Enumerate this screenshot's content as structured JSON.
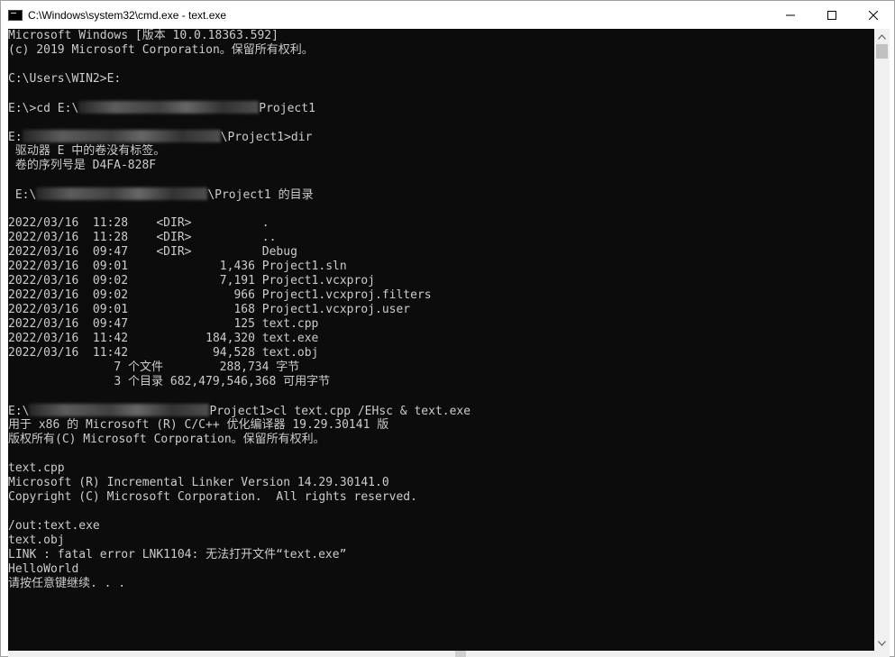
{
  "window": {
    "title": "C:\\Windows\\system32\\cmd.exe - text.exe",
    "controls": {
      "minimize": "minimize",
      "maximize": "maximize",
      "close": "close"
    }
  },
  "console": {
    "lines": [
      {
        "text": "Microsoft Windows [版本 10.0.18363.592]"
      },
      {
        "text": "(c) 2019 Microsoft Corporation。保留所有权利。"
      },
      {
        "text": ""
      },
      {
        "text": "C:\\Users\\WIN2>E:"
      },
      {
        "text": ""
      },
      {
        "prefix": "E:\\>cd E:\\",
        "blur": 200,
        "suffix": "Project1"
      },
      {
        "text": ""
      },
      {
        "prefix": "E:",
        "blur": 220,
        "suffix": "\\Project1>dir"
      },
      {
        "text": " 驱动器 E 中的卷没有标签。"
      },
      {
        "text": " 卷的序列号是 D4FA-828F"
      },
      {
        "text": ""
      },
      {
        "prefix": " E:\\",
        "blur": 190,
        "suffix": "\\Project1 的目录"
      },
      {
        "text": ""
      },
      {
        "text": "2022/03/16  11:28    <DIR>          ."
      },
      {
        "text": "2022/03/16  11:28    <DIR>          .."
      },
      {
        "text": "2022/03/16  09:47    <DIR>          Debug"
      },
      {
        "text": "2022/03/16  09:01             1,436 Project1.sln"
      },
      {
        "text": "2022/03/16  09:02             7,191 Project1.vcxproj"
      },
      {
        "text": "2022/03/16  09:02               966 Project1.vcxproj.filters"
      },
      {
        "text": "2022/03/16  09:01               168 Project1.vcxproj.user"
      },
      {
        "text": "2022/03/16  09:47               125 text.cpp"
      },
      {
        "text": "2022/03/16  11:42           184,320 text.exe"
      },
      {
        "text": "2022/03/16  11:42            94,528 text.obj"
      },
      {
        "text": "               7 个文件        288,734 字节"
      },
      {
        "text": "               3 个目录 682,479,546,368 可用字节"
      },
      {
        "text": ""
      },
      {
        "prefix": "E:\\",
        "blur": 200,
        "suffix": "Project1>cl text.cpp /EHsc & text.exe"
      },
      {
        "text": "用于 x86 的 Microsoft (R) C/C++ 优化编译器 19.29.30141 版"
      },
      {
        "text": "版权所有(C) Microsoft Corporation。保留所有权利。"
      },
      {
        "text": ""
      },
      {
        "text": "text.cpp"
      },
      {
        "text": "Microsoft (R) Incremental Linker Version 14.29.30141.0"
      },
      {
        "text": "Copyright (C) Microsoft Corporation.  All rights reserved."
      },
      {
        "text": ""
      },
      {
        "text": "/out:text.exe"
      },
      {
        "text": "text.obj"
      },
      {
        "text": "LINK : fatal error LNK1104: 无法打开文件“text.exe”"
      },
      {
        "text": "HelloWorld"
      },
      {
        "text": "请按任意键继续. . ."
      }
    ]
  },
  "colors": {
    "console_bg": "#0c0c0c",
    "console_fg": "#cccccc"
  }
}
